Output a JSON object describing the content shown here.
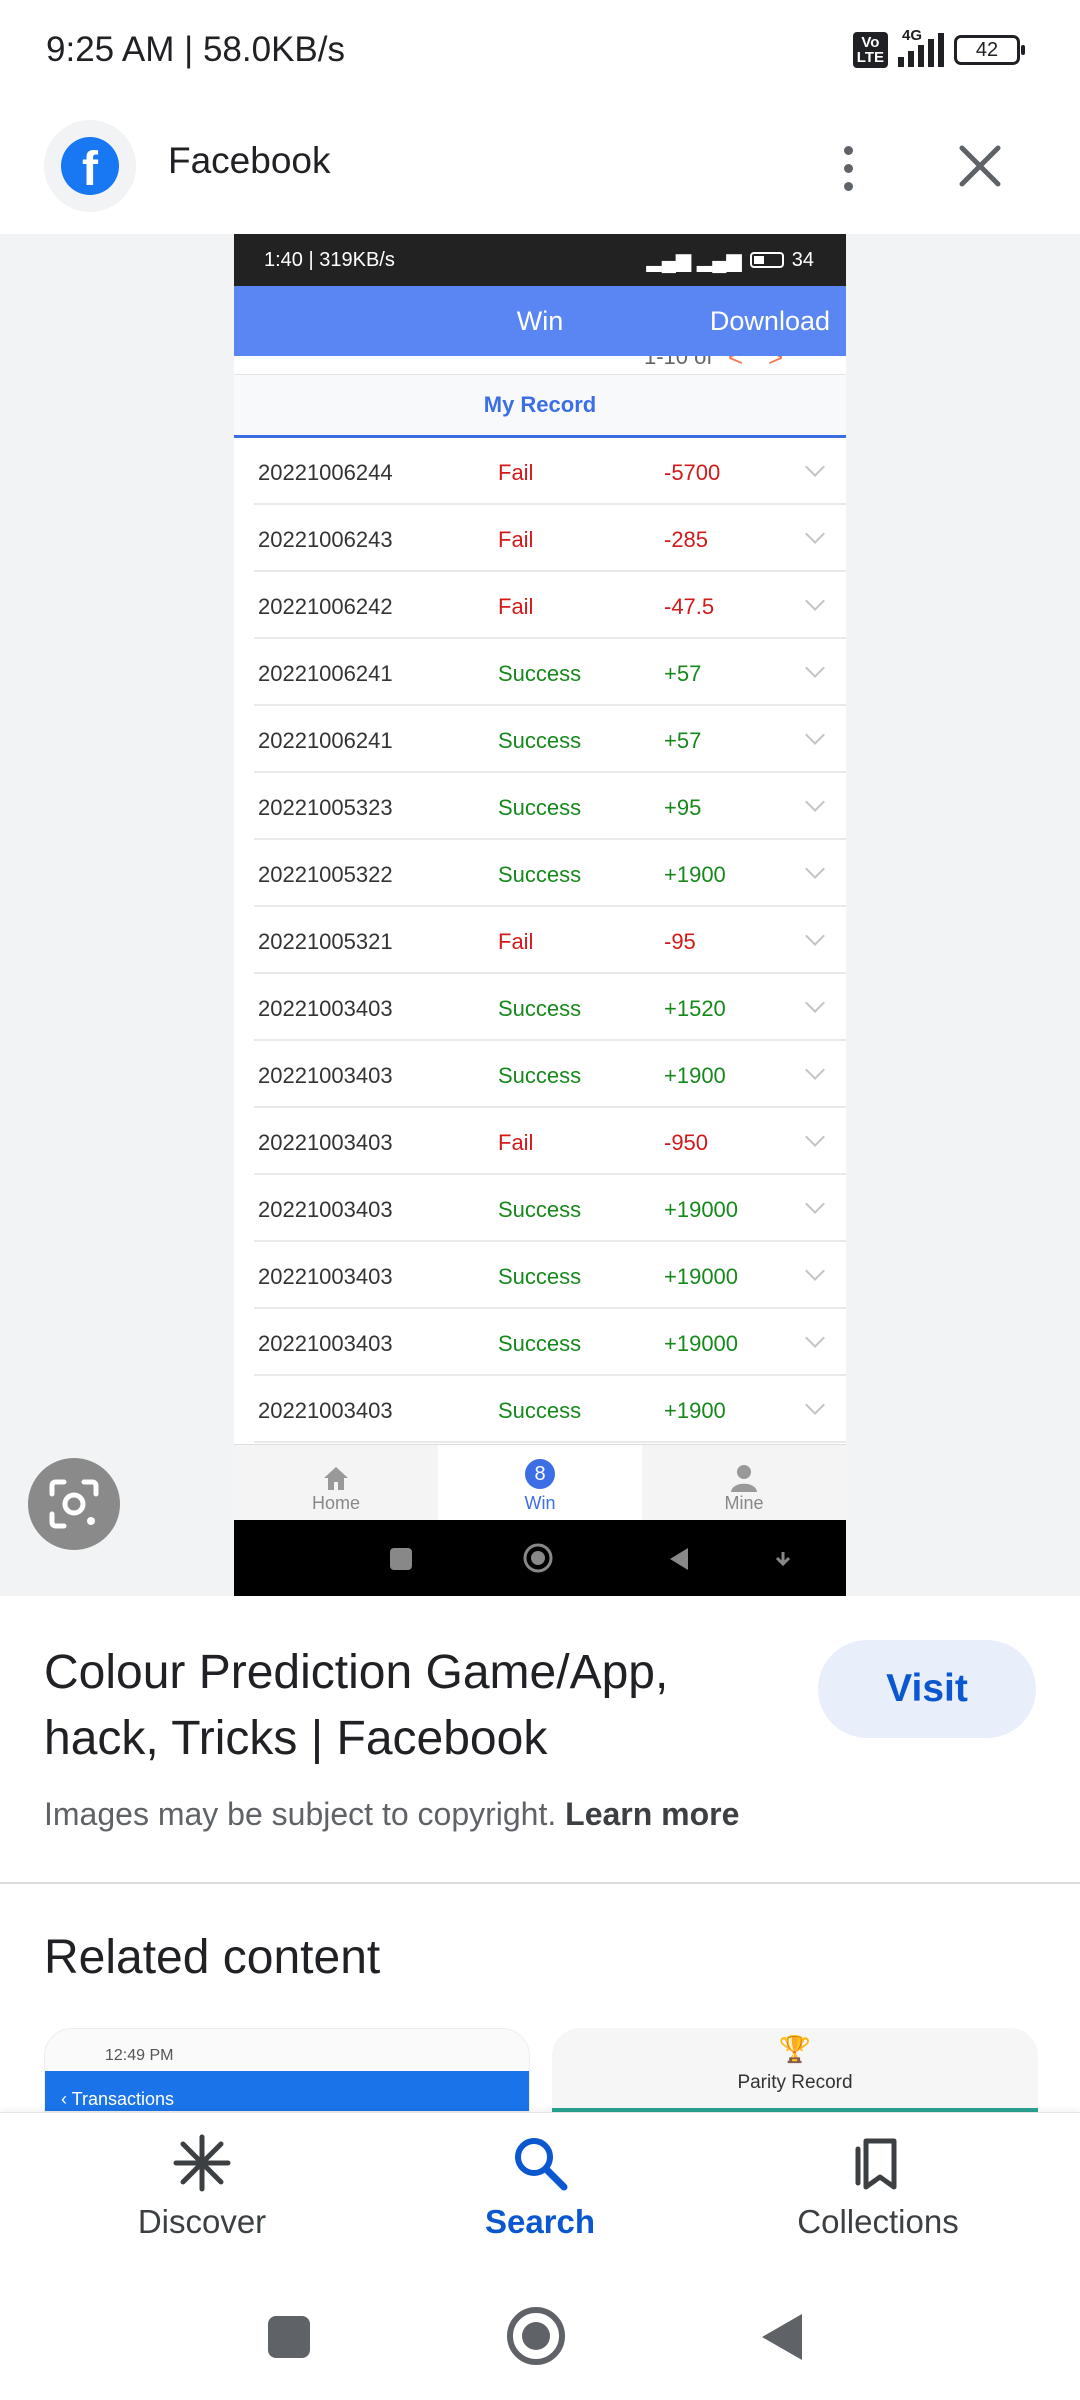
{
  "status_bar": {
    "time_speed": "9:25 AM | 58.0KB/s",
    "volte": "Vo LTE",
    "network": "4G",
    "battery": "42"
  },
  "header": {
    "title": "Facebook",
    "logo_letter": "f",
    "brand_color": "#1877f2"
  },
  "preview": {
    "status": "1:40 | 319KB/s",
    "battery": "34",
    "header_title": "Win",
    "download_label": "Download",
    "pager": "1-10 of",
    "tab_label": "My Record",
    "rows": [
      {
        "id": "20221006244",
        "status": "Fail",
        "amount": "-5700"
      },
      {
        "id": "20221006243",
        "status": "Fail",
        "amount": "-285"
      },
      {
        "id": "20221006242",
        "status": "Fail",
        "amount": "-47.5"
      },
      {
        "id": "20221006241",
        "status": "Success",
        "amount": "+57"
      },
      {
        "id": "20221006241",
        "status": "Success",
        "amount": "+57"
      },
      {
        "id": "20221005323",
        "status": "Success",
        "amount": "+95"
      },
      {
        "id": "20221005322",
        "status": "Success",
        "amount": "+1900"
      },
      {
        "id": "20221005321",
        "status": "Fail",
        "amount": "-95"
      },
      {
        "id": "20221003403",
        "status": "Success",
        "amount": "+1520"
      },
      {
        "id": "20221003403",
        "status": "Success",
        "amount": "+1900"
      },
      {
        "id": "20221003403",
        "status": "Fail",
        "amount": "-950"
      },
      {
        "id": "20221003403",
        "status": "Success",
        "amount": "+19000"
      },
      {
        "id": "20221003403",
        "status": "Success",
        "amount": "+19000"
      },
      {
        "id": "20221003403",
        "status": "Success",
        "amount": "+19000"
      },
      {
        "id": "20221003403",
        "status": "Success",
        "amount": "+1900"
      }
    ],
    "nav": {
      "home": "Home",
      "win": "Win",
      "win_badge": "8",
      "mine": "Mine"
    }
  },
  "info": {
    "title": "Colour Prediction Game/App, hack, Tricks | Facebook",
    "visit_label": "Visit",
    "copyright_text": "Images may be subject to copyright.",
    "learn_more": "Learn more"
  },
  "related": {
    "title": "Related content",
    "thumb1_status": "12:49 PM",
    "thumb1_bar": "Transactions",
    "thumb2_label": "Parity Record"
  },
  "bottom_nav": {
    "discover": "Discover",
    "search": "Search",
    "collections": "Collections"
  }
}
